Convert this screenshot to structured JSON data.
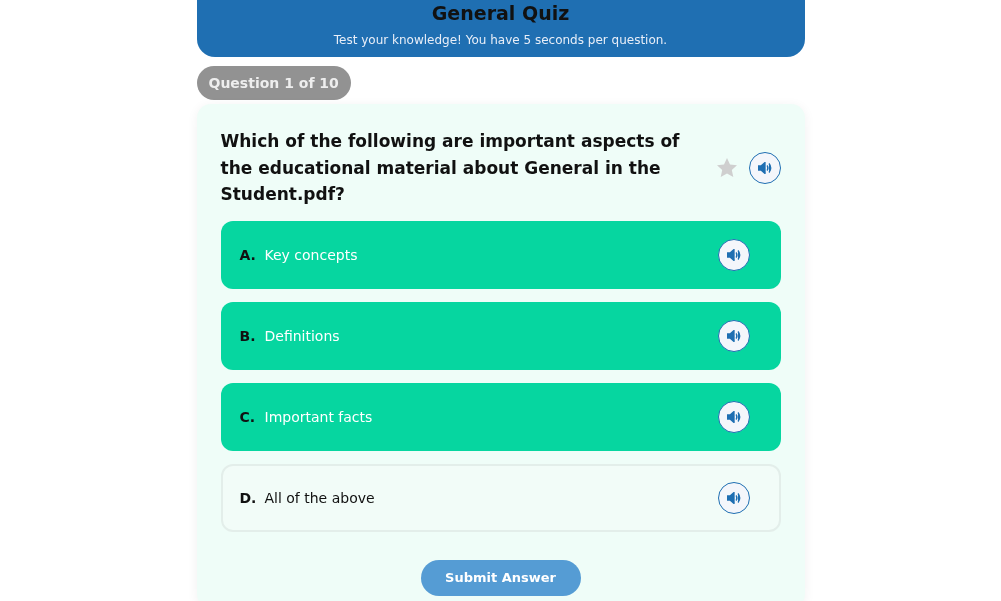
{
  "header": {
    "title": "General Quiz",
    "subtitle": "Test your knowledge! You have 5 seconds per question."
  },
  "progress": "Question 1 of 10",
  "question": {
    "text": "Which of the following are important aspects of the educational material about General in the Student.pdf?",
    "starred": false
  },
  "options": [
    {
      "letter": "A.",
      "text": "Key concepts",
      "selected": true
    },
    {
      "letter": "B.",
      "text": "Definitions",
      "selected": true
    },
    {
      "letter": "C.",
      "text": "Important facts",
      "selected": true
    },
    {
      "letter": "D.",
      "text": "All of the above",
      "selected": false
    }
  ],
  "submit": "Submit Answer"
}
